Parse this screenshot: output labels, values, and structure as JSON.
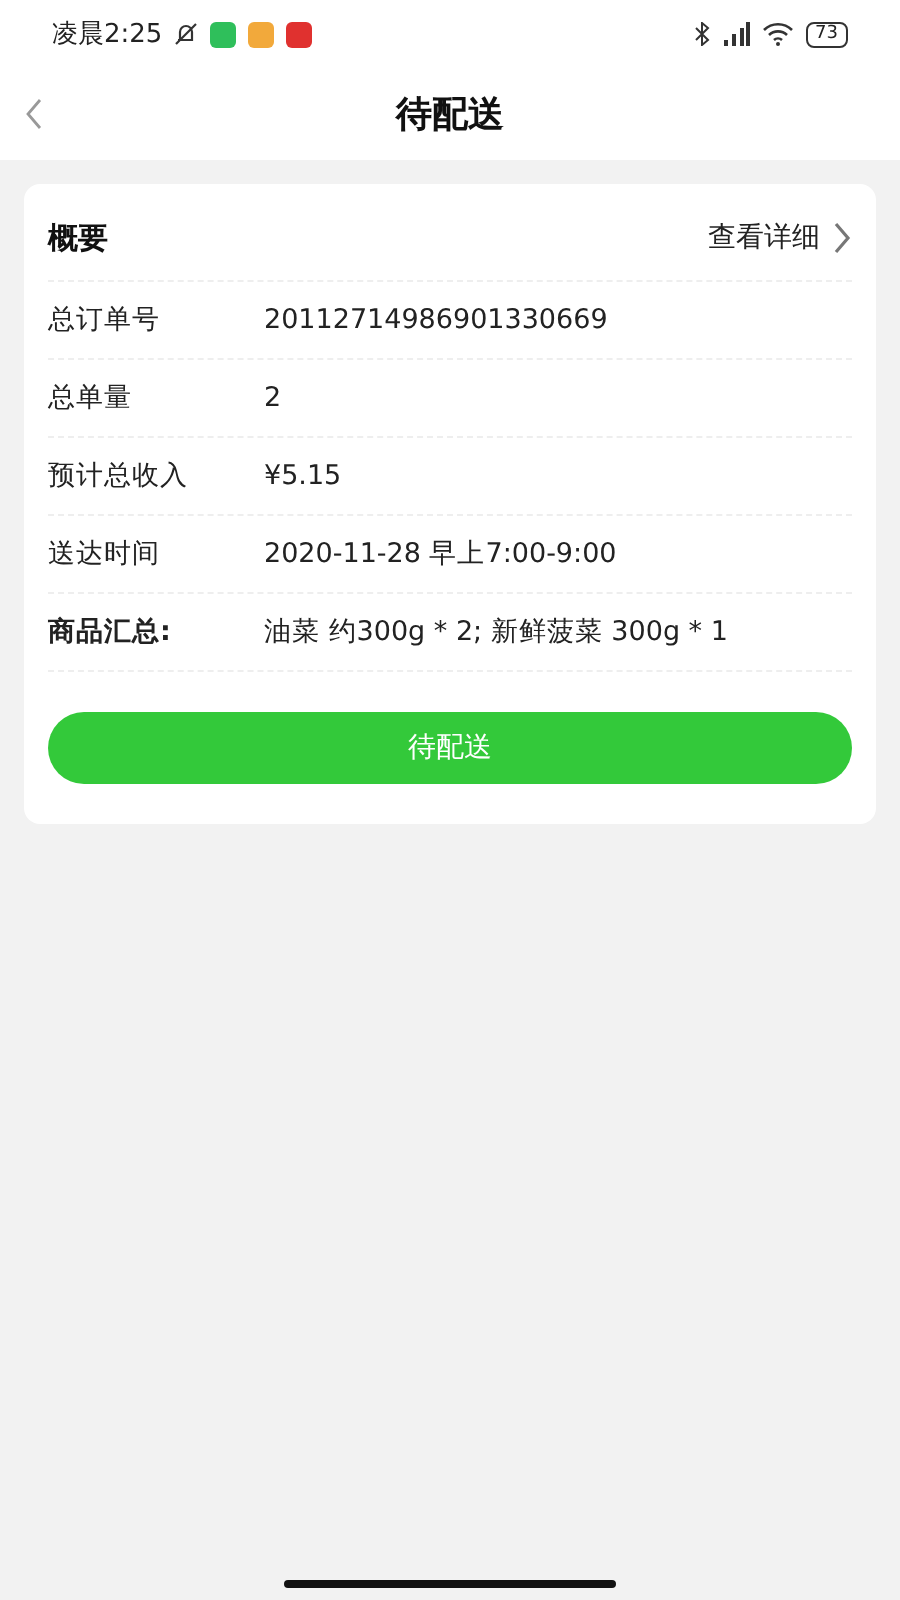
{
  "status_bar": {
    "time": "凌晨2:25",
    "battery": "73"
  },
  "header": {
    "title": "待配送"
  },
  "card": {
    "title": "概要",
    "link": "查看详细",
    "rows": [
      {
        "kind": "field",
        "label": "总订单号",
        "value": "20112714986901330669"
      },
      {
        "kind": "field",
        "label": "总单量",
        "value": "2"
      },
      {
        "kind": "field",
        "label": "预计总收入",
        "value": "¥5.15"
      },
      {
        "kind": "field",
        "label": "送达时间",
        "value": "2020-11-28 早上7:00-9:00"
      },
      {
        "kind": "summary",
        "label": "商品汇总:",
        "value": "油菜 约300g * 2; 新鲜菠菜 300g * 1"
      }
    ],
    "button": "待配送"
  }
}
